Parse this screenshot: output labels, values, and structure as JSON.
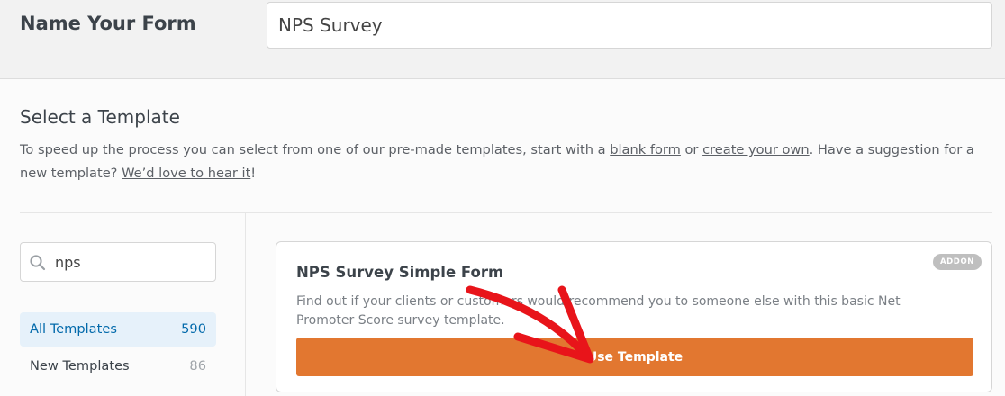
{
  "form_name": {
    "label": "Name Your Form",
    "value": "NPS Survey"
  },
  "template_section": {
    "title": "Select a Template",
    "desc_prefix": "To speed up the process you can select from one of our pre-made templates, start with a ",
    "blank_form_link": "blank form",
    "desc_or": " or ",
    "create_own_link": "create your own",
    "desc_mid": ". Have a suggestion for a new template? ",
    "love_link": "We’d love to hear it",
    "desc_end": "!"
  },
  "sidebar": {
    "search": {
      "value": "nps",
      "icon": "search-icon"
    },
    "categories": [
      {
        "label": "All Templates",
        "count": "590",
        "active": true
      },
      {
        "label": "New Templates",
        "count": "86",
        "active": false
      }
    ]
  },
  "card": {
    "title": "NPS Survey Simple Form",
    "badge": "ADDON",
    "description": "Find out if your clients or customers would recommend you to someone else with this basic Net Promoter Score survey template.",
    "button_label": "Use Template"
  },
  "colors": {
    "accent": "#e27730",
    "link_active": "#036aab",
    "annotation": "#e8141a"
  }
}
